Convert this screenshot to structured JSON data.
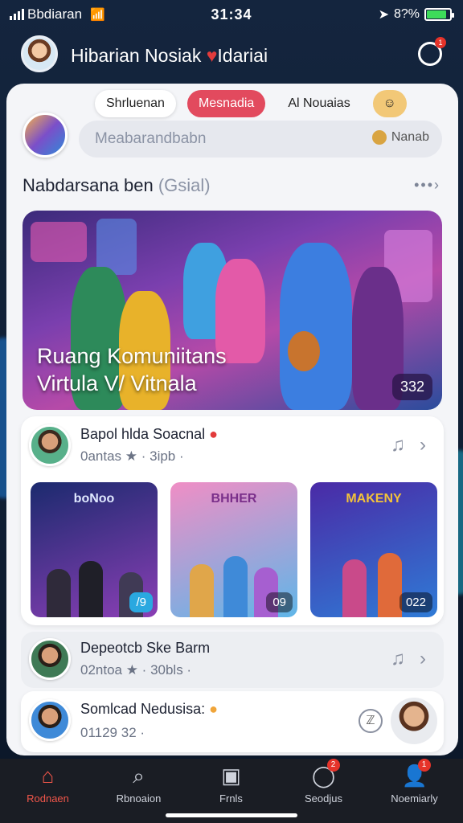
{
  "status": {
    "carrier": "Bbdiaran",
    "time": "31:34",
    "battery": "8?%"
  },
  "header": {
    "title_a": "Hibarian Nosiak",
    "title_b": "Idariai",
    "notif_count": "1"
  },
  "tabs": [
    "Shrluenan",
    "Mesnadia",
    "Al Nouaias",
    ""
  ],
  "search": {
    "placeholder": "Meabarandbabn",
    "right_label": "Nanab"
  },
  "section": {
    "title": "Nabdarsana ben",
    "subtitle": "(Gsial)",
    "more": "•••›"
  },
  "hero": {
    "title_line1": "Ruang Komuniitans",
    "title_line2": "Virtula V/ Vitnala",
    "count": "332"
  },
  "community": {
    "name": "Bapol hlda Soacnal",
    "meta": "0antas ★ · 3ipb ·",
    "thumbs": [
      {
        "label": "boNoo",
        "badge": "/9",
        "colors": [
          "#1b2a6e",
          "#8a3fb5"
        ]
      },
      {
        "label": "BHHER",
        "badge": "09",
        "colors": [
          "#f08ec5",
          "#5fb6e8"
        ]
      },
      {
        "label": "MAKENY",
        "badge": "022",
        "colors": [
          "#4a2aa6",
          "#2f7bd6"
        ]
      }
    ]
  },
  "rows": [
    {
      "name": "Depeotcb Ske Barm",
      "meta": "02ntoa ★ · 30bls ·"
    },
    {
      "name": "Somlcad Nedusisa:",
      "meta": "01129 32 ·"
    }
  ],
  "nav": [
    {
      "label": "Rodnaen",
      "icon": "home-icon",
      "badge": ""
    },
    {
      "label": "Rbnoaion",
      "icon": "search-icon",
      "badge": ""
    },
    {
      "label": "Frnls",
      "icon": "calendar-icon",
      "badge": ""
    },
    {
      "label": "Seodjus",
      "icon": "chat-icon",
      "badge": "2"
    },
    {
      "label": "Noemiarly",
      "icon": "profile-icon",
      "badge": "1"
    }
  ],
  "colors": {
    "accent": "#e24a5e",
    "nav_active": "#f0564a",
    "background": "#14253e"
  }
}
